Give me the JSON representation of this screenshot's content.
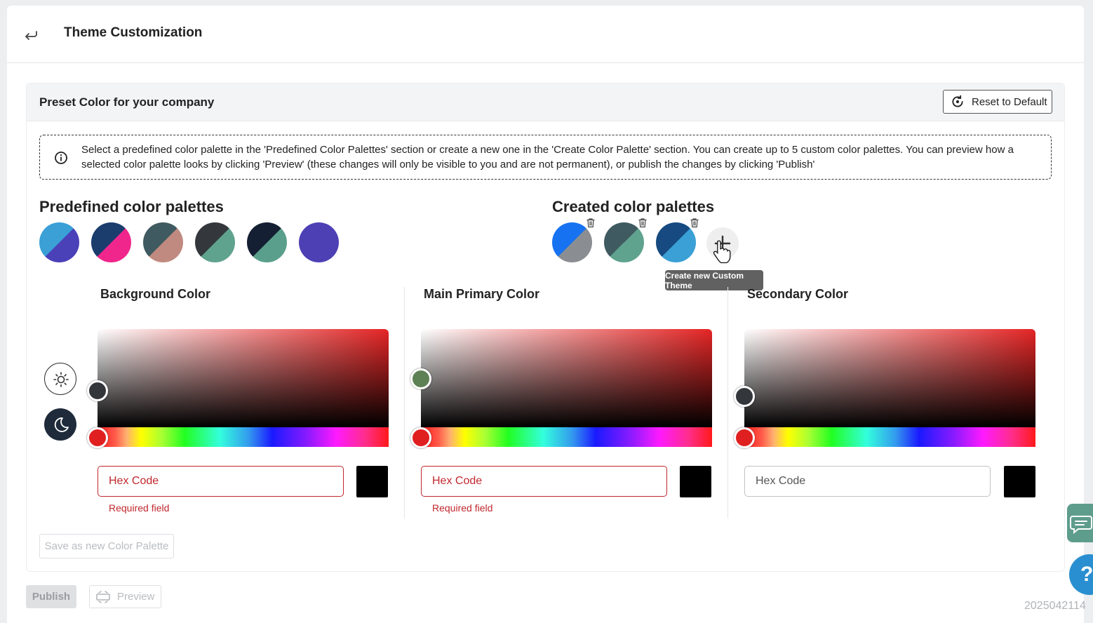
{
  "header": {
    "title": "Theme Customization"
  },
  "section": {
    "title": "Preset Color for your company",
    "reset_label": "Reset to Default",
    "info_text": "Select a predefined color palette in the 'Predefined Color Palettes' section or create a new one in the 'Create Color Palette' section. You can create up to 5 custom color palettes. You can preview how a selected color palette looks by clicking 'Preview' (these changes will only be visible to you and are not permanent), or publish the changes by clicking 'Publish'"
  },
  "predefined": {
    "title": "Predefined color palettes",
    "palettes": [
      {
        "colors": [
          "#3aa0d6",
          "#4a40b8"
        ]
      },
      {
        "colors": [
          "#1a3d6e",
          "#f0268c"
        ]
      },
      {
        "colors": [
          "#3f5a60",
          "#c08a80"
        ]
      },
      {
        "colors": [
          "#34383d",
          "#5fa38e"
        ]
      },
      {
        "colors": [
          "#151f33",
          "#5a9f8c"
        ]
      },
      {
        "colors": [
          "#4d40b5",
          "#4d40b5"
        ]
      }
    ]
  },
  "created": {
    "title": "Created color palettes",
    "palettes": [
      {
        "colors": [
          "#1672f0",
          "#8a8d91"
        ]
      },
      {
        "colors": [
          "#3f5a60",
          "#5fa38e"
        ]
      },
      {
        "colors": [
          "#164a80",
          "#3aa0d6"
        ]
      }
    ],
    "tooltip": "Create new Custom Theme"
  },
  "pickers": [
    {
      "title": "Background Color",
      "placeholder": "Hex Code",
      "error": "Required field",
      "knob_color": "#33363b"
    },
    {
      "title": "Main Primary Color",
      "placeholder": "Hex Code",
      "error": "Required field",
      "knob_color": "#5e8055"
    },
    {
      "title": "Secondary Color",
      "placeholder": "Hex Code",
      "error": "",
      "knob_color": "#33363b"
    }
  ],
  "actions": {
    "save_label": "Save as new Color Palette",
    "publish_label": "Publish",
    "preview_label": "Preview"
  },
  "colors": {
    "accent": "#1f2a3a",
    "error": "#c1272d",
    "brand": "#5e9c8c"
  },
  "footer": {
    "stamp": "2025042114"
  }
}
